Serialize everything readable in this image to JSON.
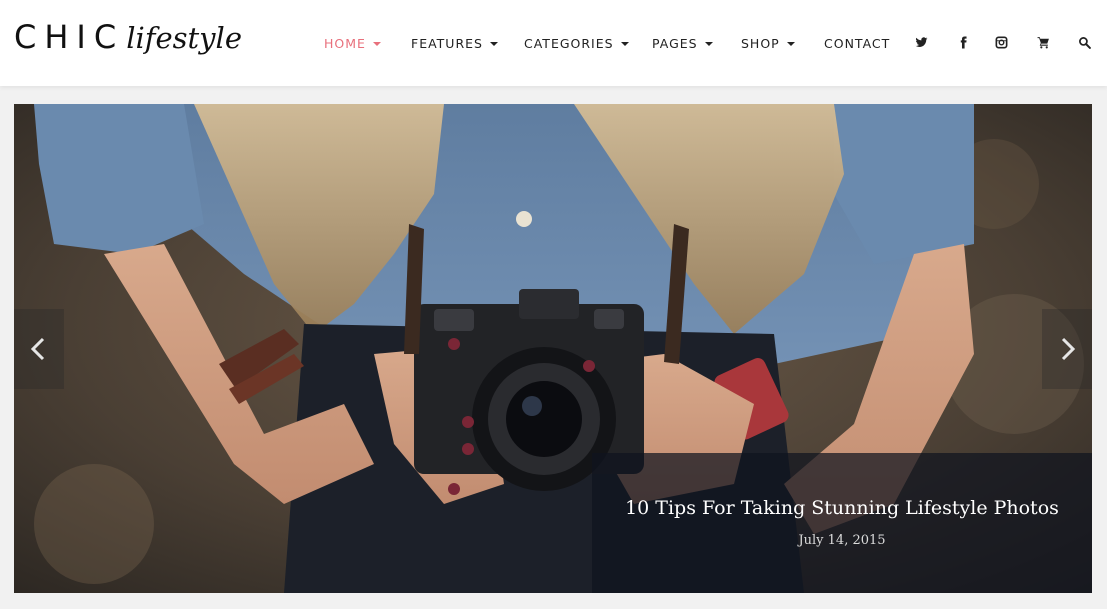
{
  "brand": {
    "logo_main": "CHIC",
    "logo_sub": "lifestyle"
  },
  "nav": {
    "items": [
      {
        "label": "HOME",
        "has_dropdown": true,
        "active": true
      },
      {
        "label": "FEATURES",
        "has_dropdown": true
      },
      {
        "label": "CATEGORIES",
        "has_dropdown": true
      },
      {
        "label": "PAGES",
        "has_dropdown": true
      },
      {
        "label": "SHOP",
        "has_dropdown": true
      },
      {
        "label": "CONTACT",
        "has_dropdown": false
      }
    ],
    "icons": [
      "twitter-icon",
      "facebook-icon",
      "instagram-icon",
      "cart-icon",
      "search-icon"
    ]
  },
  "slider": {
    "caption_title": "10 Tips For Taking Stunning Lifestyle Photos",
    "caption_date": "July 14, 2015",
    "prev_icon": "chevron-left-icon",
    "next_icon": "chevron-right-icon"
  },
  "colors": {
    "accent": "#e8707c",
    "text": "#222222",
    "caption_bg": "#0f141e"
  }
}
